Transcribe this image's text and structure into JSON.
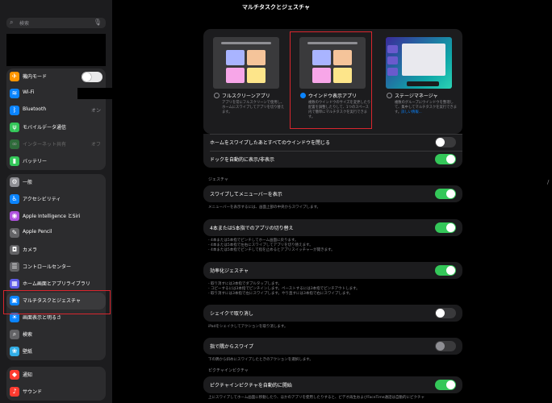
{
  "title": "マルチタスクとジェスチャ",
  "sidebar": {
    "search_placeholder": "検索",
    "group1": [
      {
        "label": "機内モード",
        "value": "",
        "icon": "airplane-icon",
        "color": "#ff9500",
        "glyph": "✈"
      },
      {
        "label": "Wi-Fi",
        "value": "",
        "icon": "wifi-icon",
        "color": "#0a84ff",
        "glyph": "≋"
      },
      {
        "label": "Bluetooth",
        "value": "オン",
        "icon": "bluetooth-icon",
        "color": "#0a84ff",
        "glyph": "ᛒ"
      },
      {
        "label": "モバイルデータ通信",
        "value": "",
        "icon": "antenna-icon",
        "color": "#34c759",
        "glyph": "ψ"
      },
      {
        "label": "インターネット共有",
        "value": "オフ",
        "icon": "hotspot-icon",
        "color": "#2e6b3a",
        "glyph": "∞"
      },
      {
        "label": "バッテリー",
        "value": "",
        "icon": "battery-icon",
        "color": "#34c759",
        "glyph": "▮"
      }
    ],
    "group2": [
      {
        "label": "一般",
        "icon": "gear-icon",
        "color": "#8e8e93",
        "glyph": "⚙"
      },
      {
        "label": "アクセシビリティ",
        "icon": "accessibility-icon",
        "color": "#0a84ff",
        "glyph": "♿"
      },
      {
        "label": "Apple Intelligence とSiri",
        "icon": "siri-icon",
        "color": "#af52de",
        "glyph": "◉"
      },
      {
        "label": "Apple Pencil",
        "icon": "pencil-icon",
        "color": "#636366",
        "glyph": "✎"
      },
      {
        "label": "カメラ",
        "icon": "camera-icon",
        "color": "#636366",
        "glyph": "◘"
      },
      {
        "label": "コントロールセンター",
        "icon": "control-center-icon",
        "color": "#636366",
        "glyph": "☰"
      },
      {
        "label": "ホーム画面とアプリライブラリ",
        "icon": "home-screen-icon",
        "color": "#5e5ce6",
        "glyph": "▦"
      },
      {
        "label": "マルチタスクとジェスチャ",
        "icon": "multitasking-icon",
        "color": "#0a84ff",
        "glyph": "▣",
        "selected": true
      },
      {
        "label": "画面表示と明るさ",
        "icon": "brightness-icon",
        "color": "#0a84ff",
        "glyph": "☀"
      },
      {
        "label": "検索",
        "icon": "search-icon",
        "color": "#636366",
        "glyph": "⌕"
      },
      {
        "label": "壁紙",
        "icon": "wallpaper-icon",
        "color": "#32ade6",
        "glyph": "❀"
      }
    ],
    "group3": [
      {
        "label": "通知",
        "icon": "notification-icon",
        "color": "#ff3b30",
        "glyph": "◆"
      },
      {
        "label": "サウンド",
        "icon": "sound-icon",
        "color": "#ff3b30",
        "glyph": "♪"
      }
    ]
  },
  "options": [
    {
      "label": "フルスクリーンアプリ",
      "desc": "アプリを常にフルスクリーンで使用し、ホームにスワイプしてアプリを切り替えます。",
      "link": "",
      "selected": false
    },
    {
      "label": "ウインドウ表示アプリ",
      "desc": "複数のウインドウのサイズを変更したり配置を調整したりして、1つのスペース内で簡単にマルチタスクを実行できます。",
      "link": "",
      "selected": true
    },
    {
      "label": "ステージマネージャ",
      "desc": "複数のグループにウインドウを整理して、集中してマルチタスクを実行できます。",
      "link": "詳しい情報...",
      "selected": false
    }
  ],
  "rows1": [
    {
      "label": "ホームをスワイプしたあとすべてのウインドウを閉じる",
      "on": false
    },
    {
      "label": "ドックを自動的に表示/非表示",
      "on": true
    }
  ],
  "gesture_header": "ジェスチャ",
  "gesture_rows": [
    {
      "label": "スワイプしてメニューバーを表示",
      "on": true,
      "note": [
        "メニューバーを表示するには、画面上部の中央からスワイプします。"
      ]
    },
    {
      "label": "4本または5本指でのアプリの切り替え",
      "on": true,
      "note": [
        "- 4本または5本指でピンチしてホーム画面に戻ります。",
        "- 4本または5本指で左右にスワイプしてアプリを切り替えます。",
        "- 4本または5本指でピンチして指を止めるとアプリスイッチャーが開きます。"
      ]
    },
    {
      "label": "効率化ジェスチャ",
      "on": true,
      "note": [
        "- 取り消すには3本指でダブルタップします。",
        "- コピーするには3本指でピンチインします。ペーストするには3本指でピンチアウトします。",
        "- 取り消すには3本指で左にスワイプします。やり直すには3本指で右にスワイプします。"
      ]
    },
    {
      "label": "シェイクで取り消し",
      "on": false,
      "note": [
        "iPadをシェイクしてアクションを取り消します。"
      ]
    },
    {
      "label": "指で隅からスワイプ",
      "on": false,
      "dim": true,
      "note": [
        "下の隅から斜めにスワイプしたときのアクションを選択します。"
      ]
    }
  ],
  "pip_header": "ピクチャインピクチャ",
  "pip_row": {
    "label": "ピクチャインピクチャを自動的に開始",
    "on": true,
    "note": [
      "上にスワイプしてホーム画面に移動したり、ほかのアプリを使用したりすると、ビデオ再生およびFaceTime通話は自動的にピクチャ"
    ]
  }
}
